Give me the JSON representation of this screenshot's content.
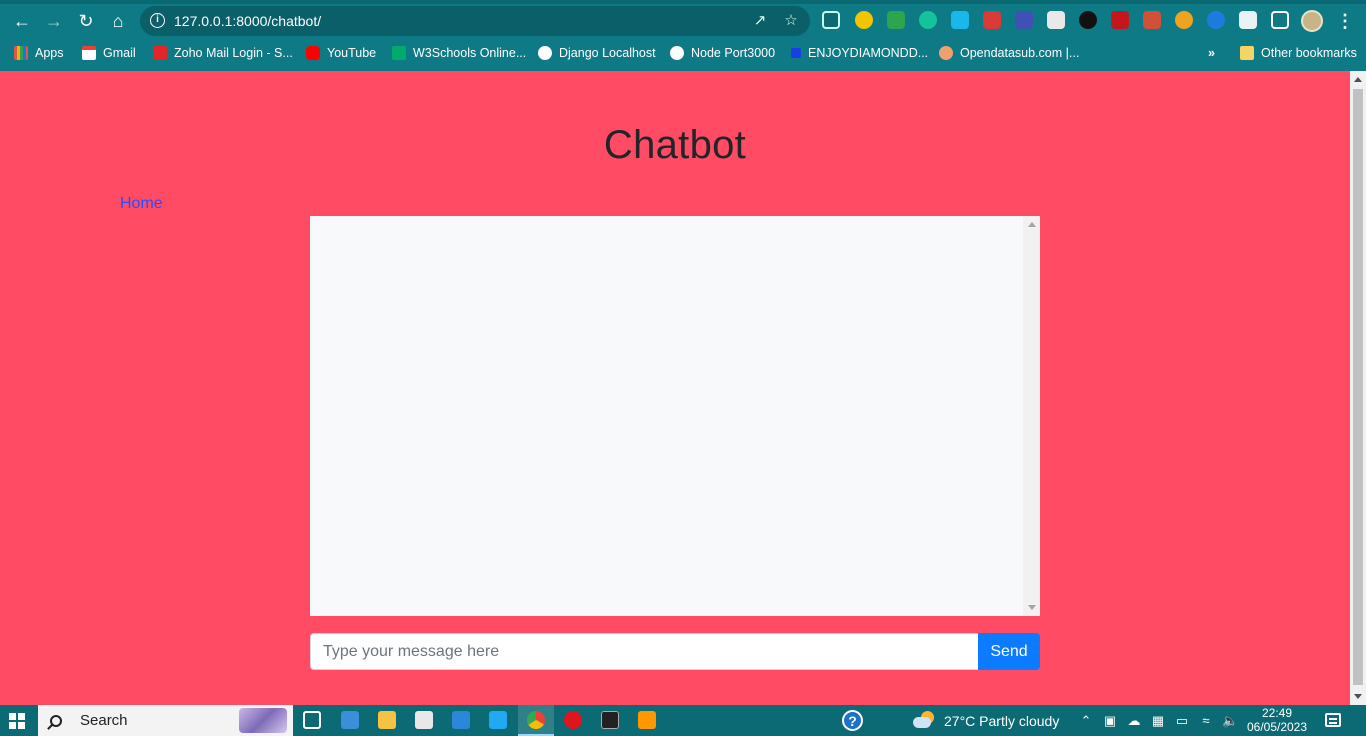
{
  "browser": {
    "url": "127.0.0.1:8000/chatbot/",
    "bookmarks": [
      {
        "label": "Apps",
        "icon": "apps-grid-icon",
        "color": "#e2574c"
      },
      {
        "label": "Gmail",
        "icon": "gmail-icon",
        "color": "#ea4335"
      },
      {
        "label": "Zoho Mail Login - S...",
        "icon": "zoho-icon",
        "color": "#e42527"
      },
      {
        "label": "YouTube",
        "icon": "youtube-icon",
        "color": "#ff0000"
      },
      {
        "label": "W3Schools Online...",
        "icon": "w3schools-icon",
        "color": "#04aa6d"
      },
      {
        "label": "Django Localhost",
        "icon": "globe-icon",
        "color": "#ffffff"
      },
      {
        "label": "Node Port3000",
        "icon": "globe-icon",
        "color": "#ffffff"
      },
      {
        "label": "ENJOYDIAMONDD...",
        "icon": "diamond-icon",
        "color": "#1a3fe0"
      },
      {
        "label": "Opendatasub.com |...",
        "icon": "opendata-icon",
        "color": "#f0a070"
      }
    ],
    "overflow_label": "»",
    "other_bookmarks": "Other bookmarks"
  },
  "page": {
    "title": "Chatbot",
    "home_link": "Home",
    "input_placeholder": "Type your message here",
    "input_value": "",
    "send_label": "Send",
    "background_color": "#ff4c64",
    "send_color": "#0d7bff"
  },
  "taskbar": {
    "search_label": "Search",
    "help_label": "?",
    "weather": "27°C  Partly cloudy",
    "time": "22:49",
    "date": "06/05/2023"
  }
}
